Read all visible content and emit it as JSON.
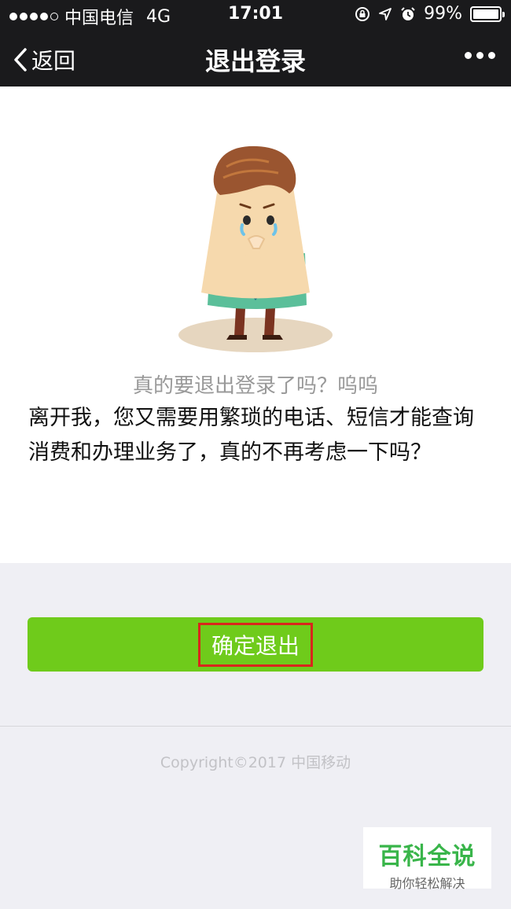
{
  "status_bar": {
    "carrier": "中国电信",
    "network": "4G",
    "time": "17:01",
    "battery": "99%",
    "battery_level": 0.99,
    "signal_strength": 4,
    "icons": [
      "lock-rotation-icon",
      "location-icon",
      "alarm-icon",
      "battery-icon"
    ]
  },
  "nav": {
    "back_label": "返回",
    "title": "退出登录",
    "more_icon": "more-dots-icon"
  },
  "content": {
    "subtitle": "真的要退出登录了吗？呜呜",
    "message": "离开我，您又需要用繁琐的电话、短信才能查询消费和办理业务了，真的不再考虑一下吗？"
  },
  "actions": {
    "confirm_label": "确定退出"
  },
  "footer": {
    "copyright": "Copyright©2017 中国移动"
  },
  "watermark": {
    "main": "百科全说",
    "sub": "助你轻松解决"
  },
  "colors": {
    "bar_bg": "#1a1a1c",
    "button_green": "#6fcb1b",
    "highlight_red": "#d9261c",
    "page_bg": "#efeff4"
  }
}
